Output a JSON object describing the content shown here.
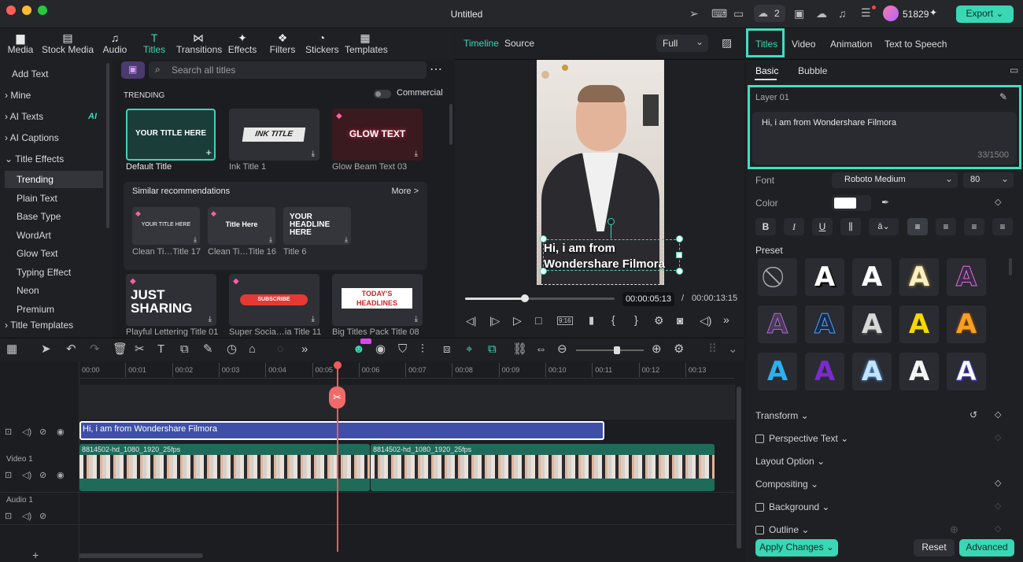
{
  "window": {
    "title": "Untitled",
    "credits": "51829",
    "notif_count": "2",
    "export_label": "Export"
  },
  "media_tabs": [
    {
      "label": "Media"
    },
    {
      "label": "Stock Media"
    },
    {
      "label": "Audio"
    },
    {
      "label": "Titles"
    },
    {
      "label": "Transitions"
    },
    {
      "label": "Effects"
    },
    {
      "label": "Filters"
    },
    {
      "label": "Stickers"
    },
    {
      "label": "Templates"
    }
  ],
  "leftnav": {
    "add_text": "Add Text",
    "mine": "Mine",
    "ai_texts": "AI Texts",
    "ai_badge": "AI",
    "ai_captions": "AI Captions",
    "title_effects": "Title Effects",
    "items": [
      "Trending",
      "Plain Text",
      "Base Type",
      "WordArt",
      "Glow Text",
      "Typing Effect",
      "Neon",
      "Premium"
    ],
    "title_templates": "Title Templates"
  },
  "browser": {
    "search_placeholder": "Search all titles",
    "section": "TRENDING",
    "commercial": "Commercial",
    "similar": "Similar recommendations",
    "more": "More >",
    "trending": [
      {
        "thumb": "YOUR TITLE HERE",
        "label": "Default Title"
      },
      {
        "thumb": "INK TITLE",
        "label": "Ink Title 1"
      },
      {
        "thumb": "GLOW TEXT",
        "label": "Glow Beam Text 03"
      }
    ],
    "similar_items": [
      {
        "thumb": "YOUR TITLE HERE",
        "label": "Clean Ti…Title 17"
      },
      {
        "thumb": "Title Here",
        "label": "Clean Ti…Title 16"
      },
      {
        "thumb": "YOUR HEADLINE HERE",
        "label": "Title 6"
      }
    ],
    "row3": [
      {
        "thumb": "JUST SHARING",
        "label": "Playful Lettering Title 01"
      },
      {
        "thumb": "SUBSCRIBE",
        "label": "Super Socia…ia Title 11"
      },
      {
        "thumb": "TODAY'S HEADLINES",
        "label": "Big Titles Pack Title 08"
      }
    ]
  },
  "preview": {
    "tab_timeline": "Timeline",
    "tab_source": "Source",
    "zoom": "Full",
    "overlay_text": "Hi, i am from Wondershare Filmora",
    "current_time": "00:00:05:13",
    "separator": "/",
    "total_time": "00:00:13:15",
    "playhead_fraction": 0.4
  },
  "inspector": {
    "tabs": [
      "Titles",
      "Video",
      "Animation",
      "Text to Speech"
    ],
    "subtabs": [
      "Basic",
      "Bubble"
    ],
    "layer": "Layer 01",
    "text": "Hi, i am from Wondershare Filmora",
    "char_count": "33/1500",
    "font_label": "Font",
    "font": "Roboto Medium",
    "size": "80",
    "color_label": "Color",
    "preset_label": "Preset",
    "sections": [
      "Transform",
      "Perspective Text",
      "Layout Option",
      "Compositing",
      "Background",
      "Outline"
    ],
    "apply": "Apply Changes",
    "reset": "Reset",
    "advanced": "Advanced"
  },
  "timeline": {
    "ruler": [
      "00:00",
      "00:01",
      "00:02",
      "00:03",
      "00:04",
      "00:05",
      "00:06",
      "00:07",
      "00:08",
      "00:09",
      "00:10",
      "00:11",
      "00:12",
      "00:13"
    ],
    "title_clip": "Hi, i am from Wondershare Filmora",
    "video_clip1": "8814502-hd_1080_1920_25fps",
    "video_clip2": "8814502-hd_1080_1920_25fps",
    "video_track": "Video 1",
    "audio_track": "Audio 1"
  },
  "colors": {
    "accent": "#3ad7b5",
    "title_clip": "#3f4fa8",
    "video_clip": "#1f6b5a",
    "playhead": "#f05a5a"
  }
}
